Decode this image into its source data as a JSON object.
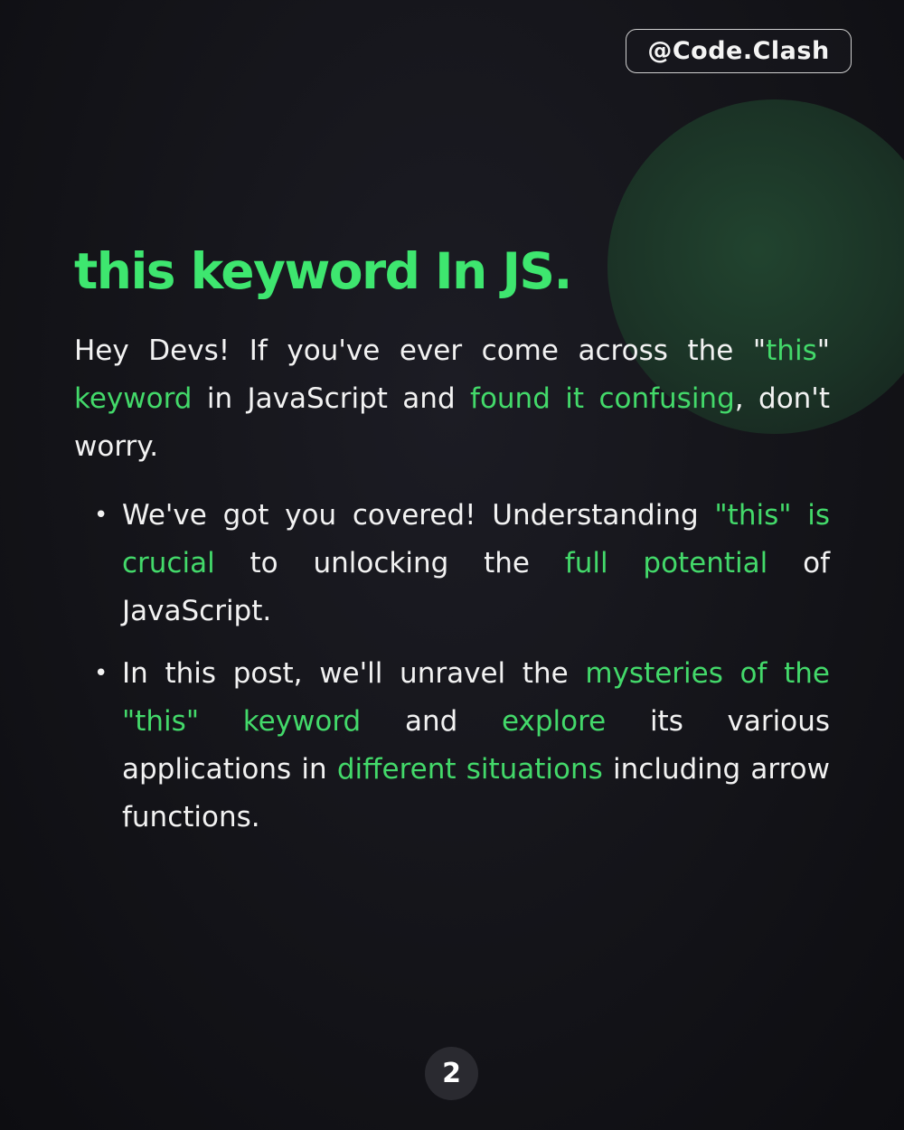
{
  "header": {
    "handle": "@Code.Clash"
  },
  "title": "this keyword In JS.",
  "intro": {
    "t1": "Hey Devs! If you've ever come across the \"",
    "h1": "this",
    "t2": "\" ",
    "h2": "keyword",
    "t3": " in JavaScript and ",
    "h3": "found it confusing",
    "t4": ", don't worry."
  },
  "bullets": [
    {
      "dot": "•",
      "t1": "We've got you covered! Understanding ",
      "h1": "\"this\" is crucial",
      "t2": " to unlocking the ",
      "h2": "full potential",
      "t3": " of JavaScript."
    },
    {
      "dot": "•",
      "t1": "In this post, we'll unravel the ",
      "h1": "mysteries of the \"this\" keyword",
      "t2": " and ",
      "h2": "explore",
      "t3": " its various applications in ",
      "h3": "different situations",
      "t4": " including arrow functions."
    }
  ],
  "footer": {
    "page_number": "2"
  },
  "colors": {
    "accent": "#3ee66f",
    "background": "#141419",
    "text": "#f2f2f2"
  }
}
